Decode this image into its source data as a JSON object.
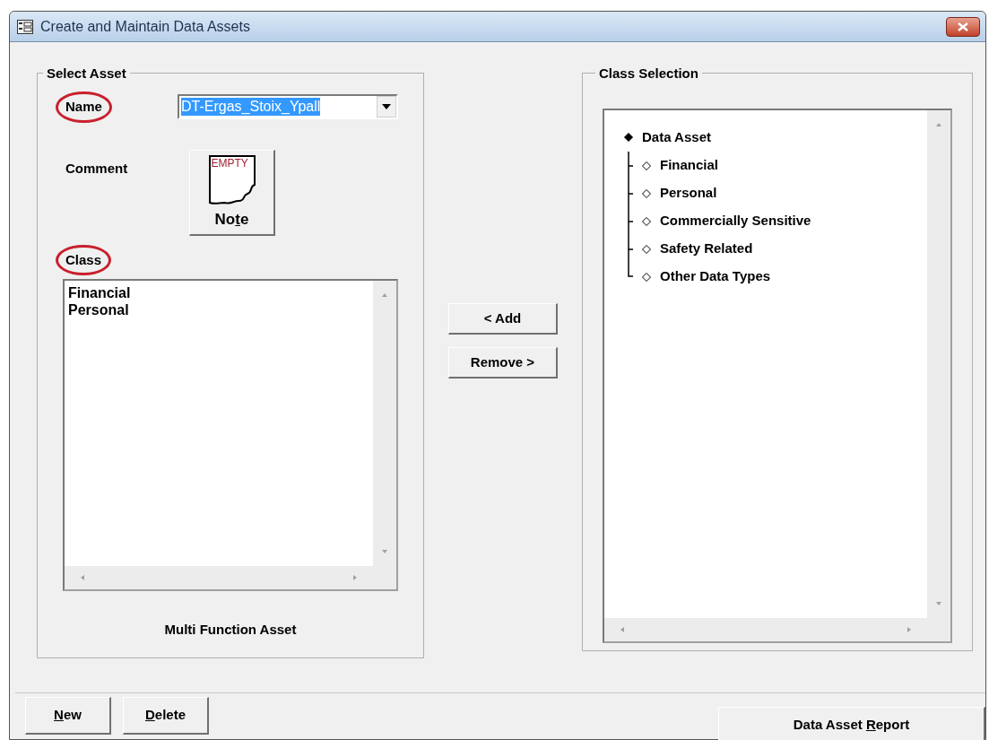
{
  "window": {
    "title": "Create and Maintain Data Assets"
  },
  "select_asset": {
    "title": "Select Asset",
    "name_label": {
      "text": "Name",
      "circled": true
    },
    "name_field": {
      "value": "DT-Ergas_Stoix_Ypall",
      "text_selected": true
    },
    "comment_label": {
      "text": "Comment",
      "circled": false
    },
    "note_button": {
      "status": "EMPTY",
      "label": {
        "before": "No",
        "key": "t",
        "after": "e"
      }
    },
    "class_label": {
      "text": "Class",
      "circled": true
    },
    "class_list": [
      "Financial",
      "Personal"
    ],
    "caption": "Multi Function Asset"
  },
  "add_button": "< Add",
  "remove_button": "Remove >",
  "class_selection": {
    "title": "Class Selection",
    "tree": [
      {
        "label": "Data Asset",
        "selected": true,
        "children": [
          {
            "label": "Financial",
            "selected": false
          },
          {
            "label": "Personal",
            "selected": false
          },
          {
            "label": "Commercially Sensitive",
            "selected": false
          },
          {
            "label": "Safety Related",
            "selected": false
          },
          {
            "label": "Other Data Types",
            "selected": false
          }
        ]
      }
    ]
  },
  "footer": {
    "left_buttons": [
      {
        "key": "N",
        "after": "ew"
      },
      {
        "key": "D",
        "after": "elete"
      }
    ],
    "right_buttons": [
      {
        "before": "Data Asset ",
        "key": "R",
        "after": "eport"
      }
    ]
  }
}
